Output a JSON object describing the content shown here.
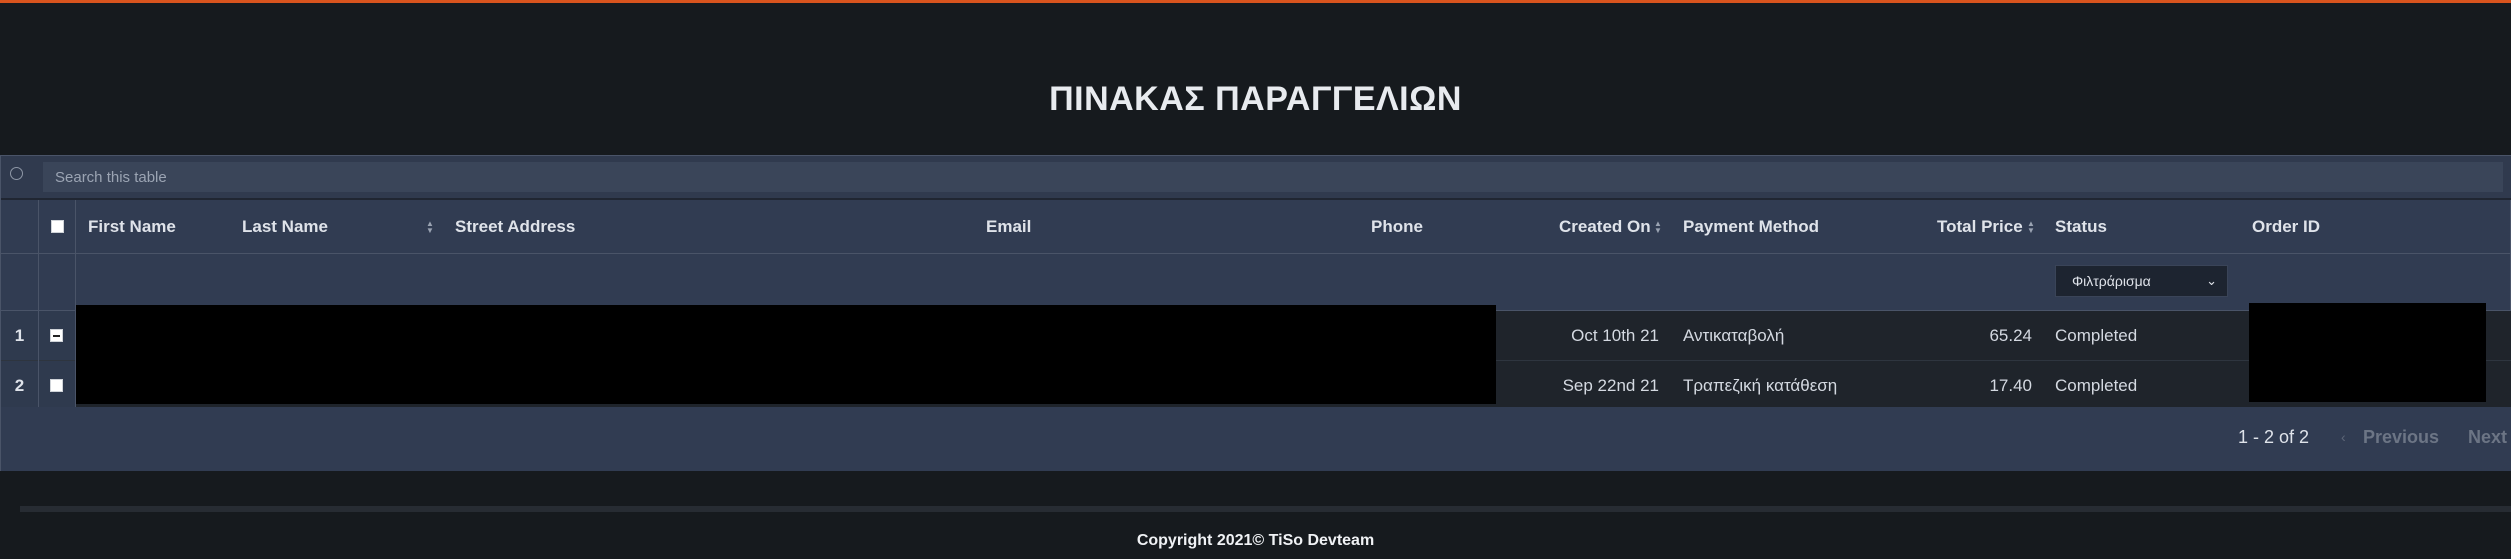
{
  "page": {
    "title": "ΠΙΝΑΚΑΣ ΠΑΡΑΓΓΕΛΙΩΝ",
    "accent_color": "#d9541e"
  },
  "search": {
    "placeholder": "Search this table",
    "value": ""
  },
  "table": {
    "columns": {
      "first_name": "First Name",
      "last_name": "Last Name",
      "street_address": "Street Address",
      "email": "Email",
      "phone": "Phone",
      "created_on": "Created On",
      "payment_method": "Payment Method",
      "total_price": "Total Price",
      "status": "Status",
      "order_id": "Order ID"
    },
    "status_filter": {
      "selected": "Φιλτράρισμα"
    },
    "rows": [
      {
        "index": "1",
        "created_on": "Oct 10th 21",
        "payment_method": "Αντικαταβολή",
        "total_price": "65.24",
        "status": "Completed"
      },
      {
        "index": "2",
        "created_on": "Sep 22nd 21",
        "payment_method": "Τραπεζική κατάθεση",
        "total_price": "17.40",
        "status": "Completed"
      }
    ]
  },
  "pagination": {
    "info": "1 - 2 of 2",
    "previous": "Previous",
    "next": "Next"
  },
  "footer": {
    "copyright": "Copyright 2021© TiSo Devteam"
  }
}
